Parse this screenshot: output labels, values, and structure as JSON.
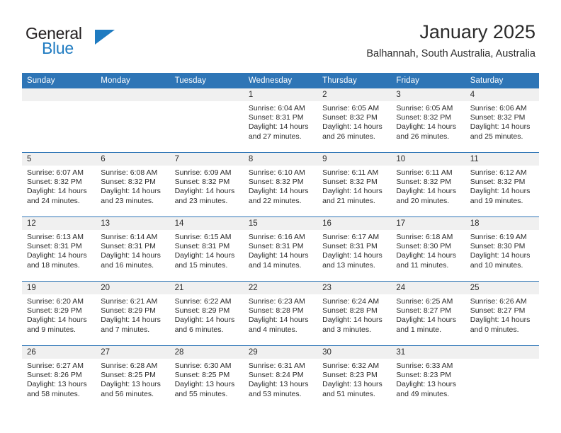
{
  "brand": {
    "name_part1": "General",
    "name_part2": "Blue",
    "accent_color": "#1f7bc1"
  },
  "header": {
    "title": "January 2025",
    "subtitle": "Balhannah, South Australia, Australia"
  },
  "theme": {
    "header_row_bg": "#2e75b6",
    "daynum_band_bg": "#f0f0f0",
    "text_color": "#2b2b2b"
  },
  "calendar": {
    "weekday_headers": [
      "Sunday",
      "Monday",
      "Tuesday",
      "Wednesday",
      "Thursday",
      "Friday",
      "Saturday"
    ],
    "weeks": [
      [
        {
          "day": "",
          "empty": true
        },
        {
          "day": "",
          "empty": true
        },
        {
          "day": "",
          "empty": true
        },
        {
          "day": "1",
          "sunrise": "Sunrise: 6:04 AM",
          "sunset": "Sunset: 8:31 PM",
          "daylight1": "Daylight: 14 hours",
          "daylight2": "and 27 minutes."
        },
        {
          "day": "2",
          "sunrise": "Sunrise: 6:05 AM",
          "sunset": "Sunset: 8:32 PM",
          "daylight1": "Daylight: 14 hours",
          "daylight2": "and 26 minutes."
        },
        {
          "day": "3",
          "sunrise": "Sunrise: 6:05 AM",
          "sunset": "Sunset: 8:32 PM",
          "daylight1": "Daylight: 14 hours",
          "daylight2": "and 26 minutes."
        },
        {
          "day": "4",
          "sunrise": "Sunrise: 6:06 AM",
          "sunset": "Sunset: 8:32 PM",
          "daylight1": "Daylight: 14 hours",
          "daylight2": "and 25 minutes."
        }
      ],
      [
        {
          "day": "5",
          "sunrise": "Sunrise: 6:07 AM",
          "sunset": "Sunset: 8:32 PM",
          "daylight1": "Daylight: 14 hours",
          "daylight2": "and 24 minutes."
        },
        {
          "day": "6",
          "sunrise": "Sunrise: 6:08 AM",
          "sunset": "Sunset: 8:32 PM",
          "daylight1": "Daylight: 14 hours",
          "daylight2": "and 23 minutes."
        },
        {
          "day": "7",
          "sunrise": "Sunrise: 6:09 AM",
          "sunset": "Sunset: 8:32 PM",
          "daylight1": "Daylight: 14 hours",
          "daylight2": "and 23 minutes."
        },
        {
          "day": "8",
          "sunrise": "Sunrise: 6:10 AM",
          "sunset": "Sunset: 8:32 PM",
          "daylight1": "Daylight: 14 hours",
          "daylight2": "and 22 minutes."
        },
        {
          "day": "9",
          "sunrise": "Sunrise: 6:11 AM",
          "sunset": "Sunset: 8:32 PM",
          "daylight1": "Daylight: 14 hours",
          "daylight2": "and 21 minutes."
        },
        {
          "day": "10",
          "sunrise": "Sunrise: 6:11 AM",
          "sunset": "Sunset: 8:32 PM",
          "daylight1": "Daylight: 14 hours",
          "daylight2": "and 20 minutes."
        },
        {
          "day": "11",
          "sunrise": "Sunrise: 6:12 AM",
          "sunset": "Sunset: 8:32 PM",
          "daylight1": "Daylight: 14 hours",
          "daylight2": "and 19 minutes."
        }
      ],
      [
        {
          "day": "12",
          "sunrise": "Sunrise: 6:13 AM",
          "sunset": "Sunset: 8:31 PM",
          "daylight1": "Daylight: 14 hours",
          "daylight2": "and 18 minutes."
        },
        {
          "day": "13",
          "sunrise": "Sunrise: 6:14 AM",
          "sunset": "Sunset: 8:31 PM",
          "daylight1": "Daylight: 14 hours",
          "daylight2": "and 16 minutes."
        },
        {
          "day": "14",
          "sunrise": "Sunrise: 6:15 AM",
          "sunset": "Sunset: 8:31 PM",
          "daylight1": "Daylight: 14 hours",
          "daylight2": "and 15 minutes."
        },
        {
          "day": "15",
          "sunrise": "Sunrise: 6:16 AM",
          "sunset": "Sunset: 8:31 PM",
          "daylight1": "Daylight: 14 hours",
          "daylight2": "and 14 minutes."
        },
        {
          "day": "16",
          "sunrise": "Sunrise: 6:17 AM",
          "sunset": "Sunset: 8:31 PM",
          "daylight1": "Daylight: 14 hours",
          "daylight2": "and 13 minutes."
        },
        {
          "day": "17",
          "sunrise": "Sunrise: 6:18 AM",
          "sunset": "Sunset: 8:30 PM",
          "daylight1": "Daylight: 14 hours",
          "daylight2": "and 11 minutes."
        },
        {
          "day": "18",
          "sunrise": "Sunrise: 6:19 AM",
          "sunset": "Sunset: 8:30 PM",
          "daylight1": "Daylight: 14 hours",
          "daylight2": "and 10 minutes."
        }
      ],
      [
        {
          "day": "19",
          "sunrise": "Sunrise: 6:20 AM",
          "sunset": "Sunset: 8:29 PM",
          "daylight1": "Daylight: 14 hours",
          "daylight2": "and 9 minutes."
        },
        {
          "day": "20",
          "sunrise": "Sunrise: 6:21 AM",
          "sunset": "Sunset: 8:29 PM",
          "daylight1": "Daylight: 14 hours",
          "daylight2": "and 7 minutes."
        },
        {
          "day": "21",
          "sunrise": "Sunrise: 6:22 AM",
          "sunset": "Sunset: 8:29 PM",
          "daylight1": "Daylight: 14 hours",
          "daylight2": "and 6 minutes."
        },
        {
          "day": "22",
          "sunrise": "Sunrise: 6:23 AM",
          "sunset": "Sunset: 8:28 PM",
          "daylight1": "Daylight: 14 hours",
          "daylight2": "and 4 minutes."
        },
        {
          "day": "23",
          "sunrise": "Sunrise: 6:24 AM",
          "sunset": "Sunset: 8:28 PM",
          "daylight1": "Daylight: 14 hours",
          "daylight2": "and 3 minutes."
        },
        {
          "day": "24",
          "sunrise": "Sunrise: 6:25 AM",
          "sunset": "Sunset: 8:27 PM",
          "daylight1": "Daylight: 14 hours",
          "daylight2": "and 1 minute."
        },
        {
          "day": "25",
          "sunrise": "Sunrise: 6:26 AM",
          "sunset": "Sunset: 8:27 PM",
          "daylight1": "Daylight: 14 hours",
          "daylight2": "and 0 minutes."
        }
      ],
      [
        {
          "day": "26",
          "sunrise": "Sunrise: 6:27 AM",
          "sunset": "Sunset: 8:26 PM",
          "daylight1": "Daylight: 13 hours",
          "daylight2": "and 58 minutes."
        },
        {
          "day": "27",
          "sunrise": "Sunrise: 6:28 AM",
          "sunset": "Sunset: 8:25 PM",
          "daylight1": "Daylight: 13 hours",
          "daylight2": "and 56 minutes."
        },
        {
          "day": "28",
          "sunrise": "Sunrise: 6:30 AM",
          "sunset": "Sunset: 8:25 PM",
          "daylight1": "Daylight: 13 hours",
          "daylight2": "and 55 minutes."
        },
        {
          "day": "29",
          "sunrise": "Sunrise: 6:31 AM",
          "sunset": "Sunset: 8:24 PM",
          "daylight1": "Daylight: 13 hours",
          "daylight2": "and 53 minutes."
        },
        {
          "day": "30",
          "sunrise": "Sunrise: 6:32 AM",
          "sunset": "Sunset: 8:23 PM",
          "daylight1": "Daylight: 13 hours",
          "daylight2": "and 51 minutes."
        },
        {
          "day": "31",
          "sunrise": "Sunrise: 6:33 AM",
          "sunset": "Sunset: 8:23 PM",
          "daylight1": "Daylight: 13 hours",
          "daylight2": "and 49 minutes."
        },
        {
          "day": "",
          "empty": true
        }
      ]
    ]
  }
}
